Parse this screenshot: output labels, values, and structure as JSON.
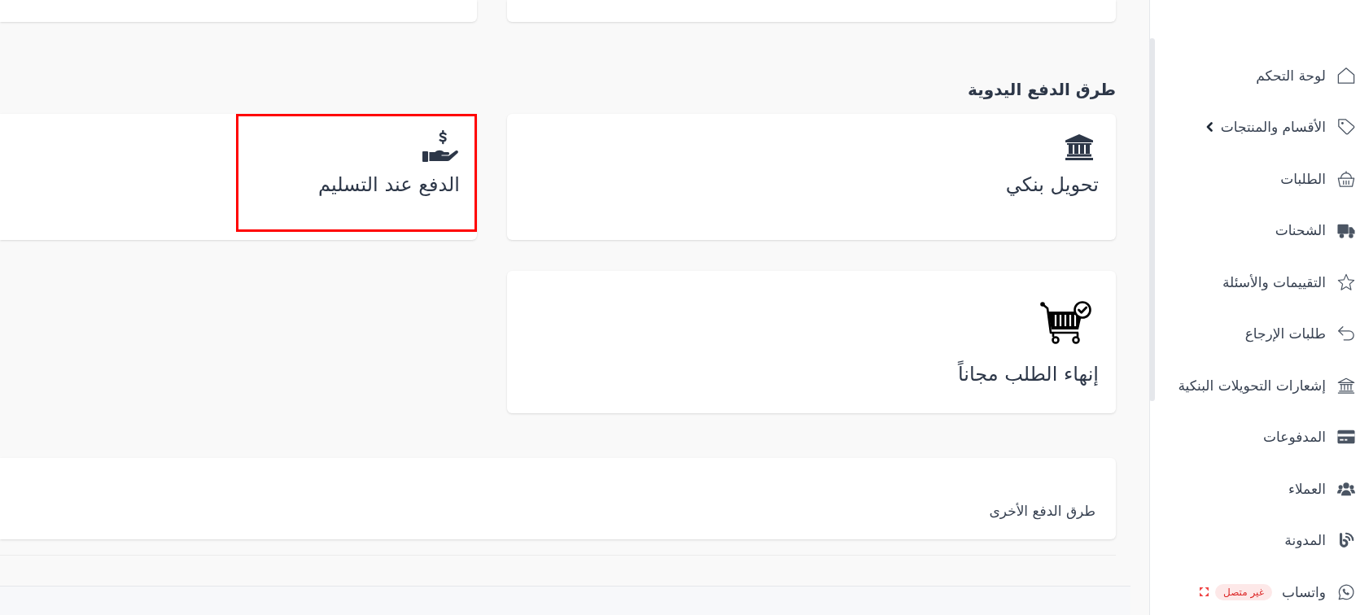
{
  "manual_payment": {
    "heading": "طرق الدفع اليدوية",
    "methods": [
      {
        "kind": "bank",
        "label": "تحويل بنكي",
        "highlighted": false
      },
      {
        "kind": "cash",
        "label": "الدفع عند التسليم",
        "highlighted": true
      },
      {
        "kind": "free",
        "label": "إنهاء الطلب مجاناً",
        "highlighted": false
      }
    ]
  },
  "other_payment": {
    "title": "طرق الدفع الأخرى"
  },
  "sidebar": {
    "items": [
      {
        "kind": "dashboard",
        "label": "لوحة التحكم",
        "submenu": false
      },
      {
        "kind": "catalog",
        "label": "الأقسام والمنتجات",
        "submenu": true
      },
      {
        "kind": "orders",
        "label": "الطلبات",
        "submenu": false
      },
      {
        "kind": "shipments",
        "label": "الشحنات",
        "submenu": false
      },
      {
        "kind": "reviews",
        "label": "التقييمات والأسئلة",
        "submenu": false
      },
      {
        "kind": "returns",
        "label": "طلبات الإرجاع",
        "submenu": false
      },
      {
        "kind": "transfers",
        "label": "إشعارات التحويلات البنكية",
        "submenu": false
      },
      {
        "kind": "payments",
        "label": "المدفوعات",
        "submenu": false
      },
      {
        "kind": "customers",
        "label": "العملاء",
        "submenu": false
      },
      {
        "kind": "blog",
        "label": "المدونة",
        "submenu": false
      },
      {
        "kind": "whatsapp",
        "label": "واتساب",
        "submenu": false,
        "badge": "غير متصل"
      }
    ]
  }
}
